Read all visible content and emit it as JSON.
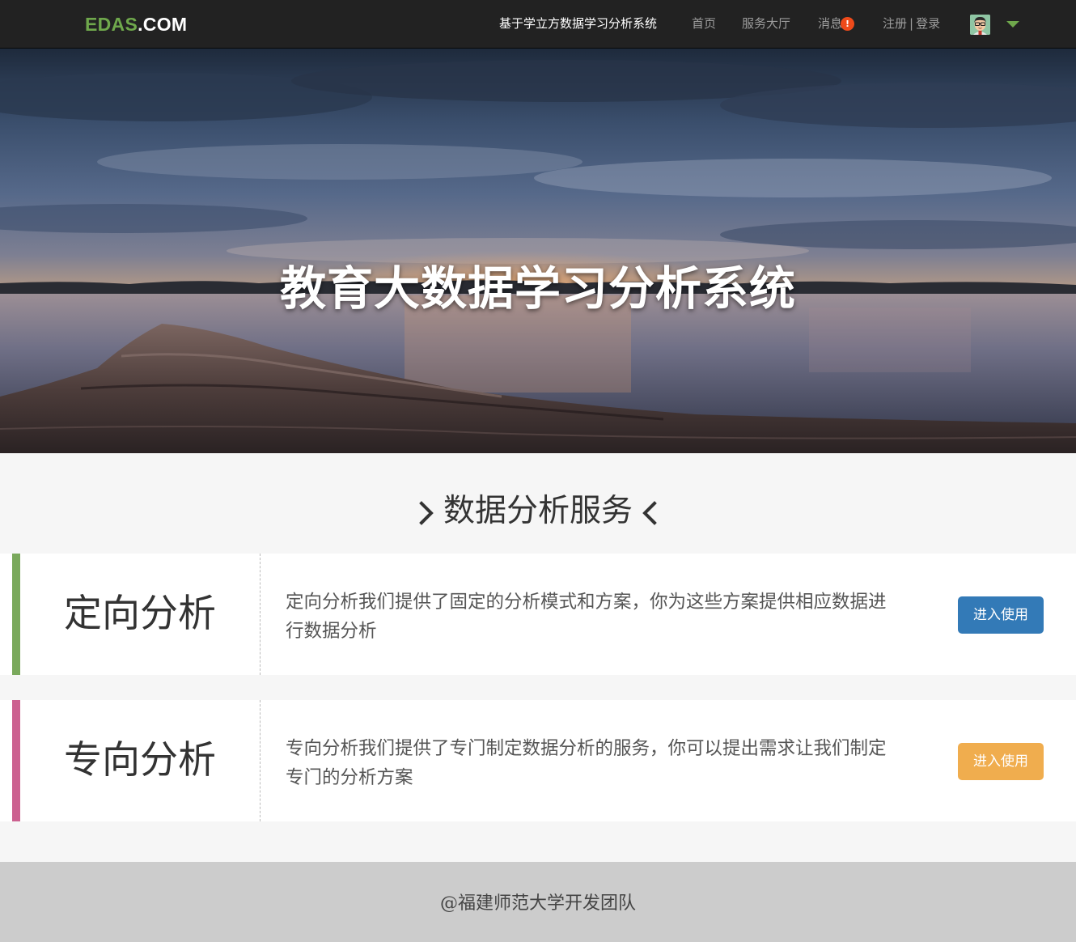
{
  "navbar": {
    "brand_part1": "EDAS",
    "brand_part2": ".COM",
    "system_title": "基于学立方数据学习分析系统",
    "home": "首页",
    "service_hall": "服务大厅",
    "messages": "消息",
    "messages_badge": "!",
    "register": "注册",
    "auth_separator": "|",
    "login": "登录",
    "user_menu_icon": "caret-down-icon"
  },
  "hero": {
    "title": "教育大数据学习分析系统"
  },
  "services": {
    "heading": "数据分析服务",
    "items": [
      {
        "title": "定向分析",
        "description": "定向分析我们提供了固定的分析模式和方案，你为这些方案提供相应数据进行数据分析",
        "button": "进入使用",
        "accent_color": "#7aa95c",
        "button_color": "#337ab7"
      },
      {
        "title": "专向分析",
        "description": "专向分析我们提供了专门制定数据分析的服务，你可以提出需求让我们制定专门的分析方案",
        "button": "进入使用",
        "accent_color": "#cc6190",
        "button_color": "#f0ad4e"
      }
    ]
  },
  "footer": {
    "text": "@福建师范大学开发团队"
  }
}
